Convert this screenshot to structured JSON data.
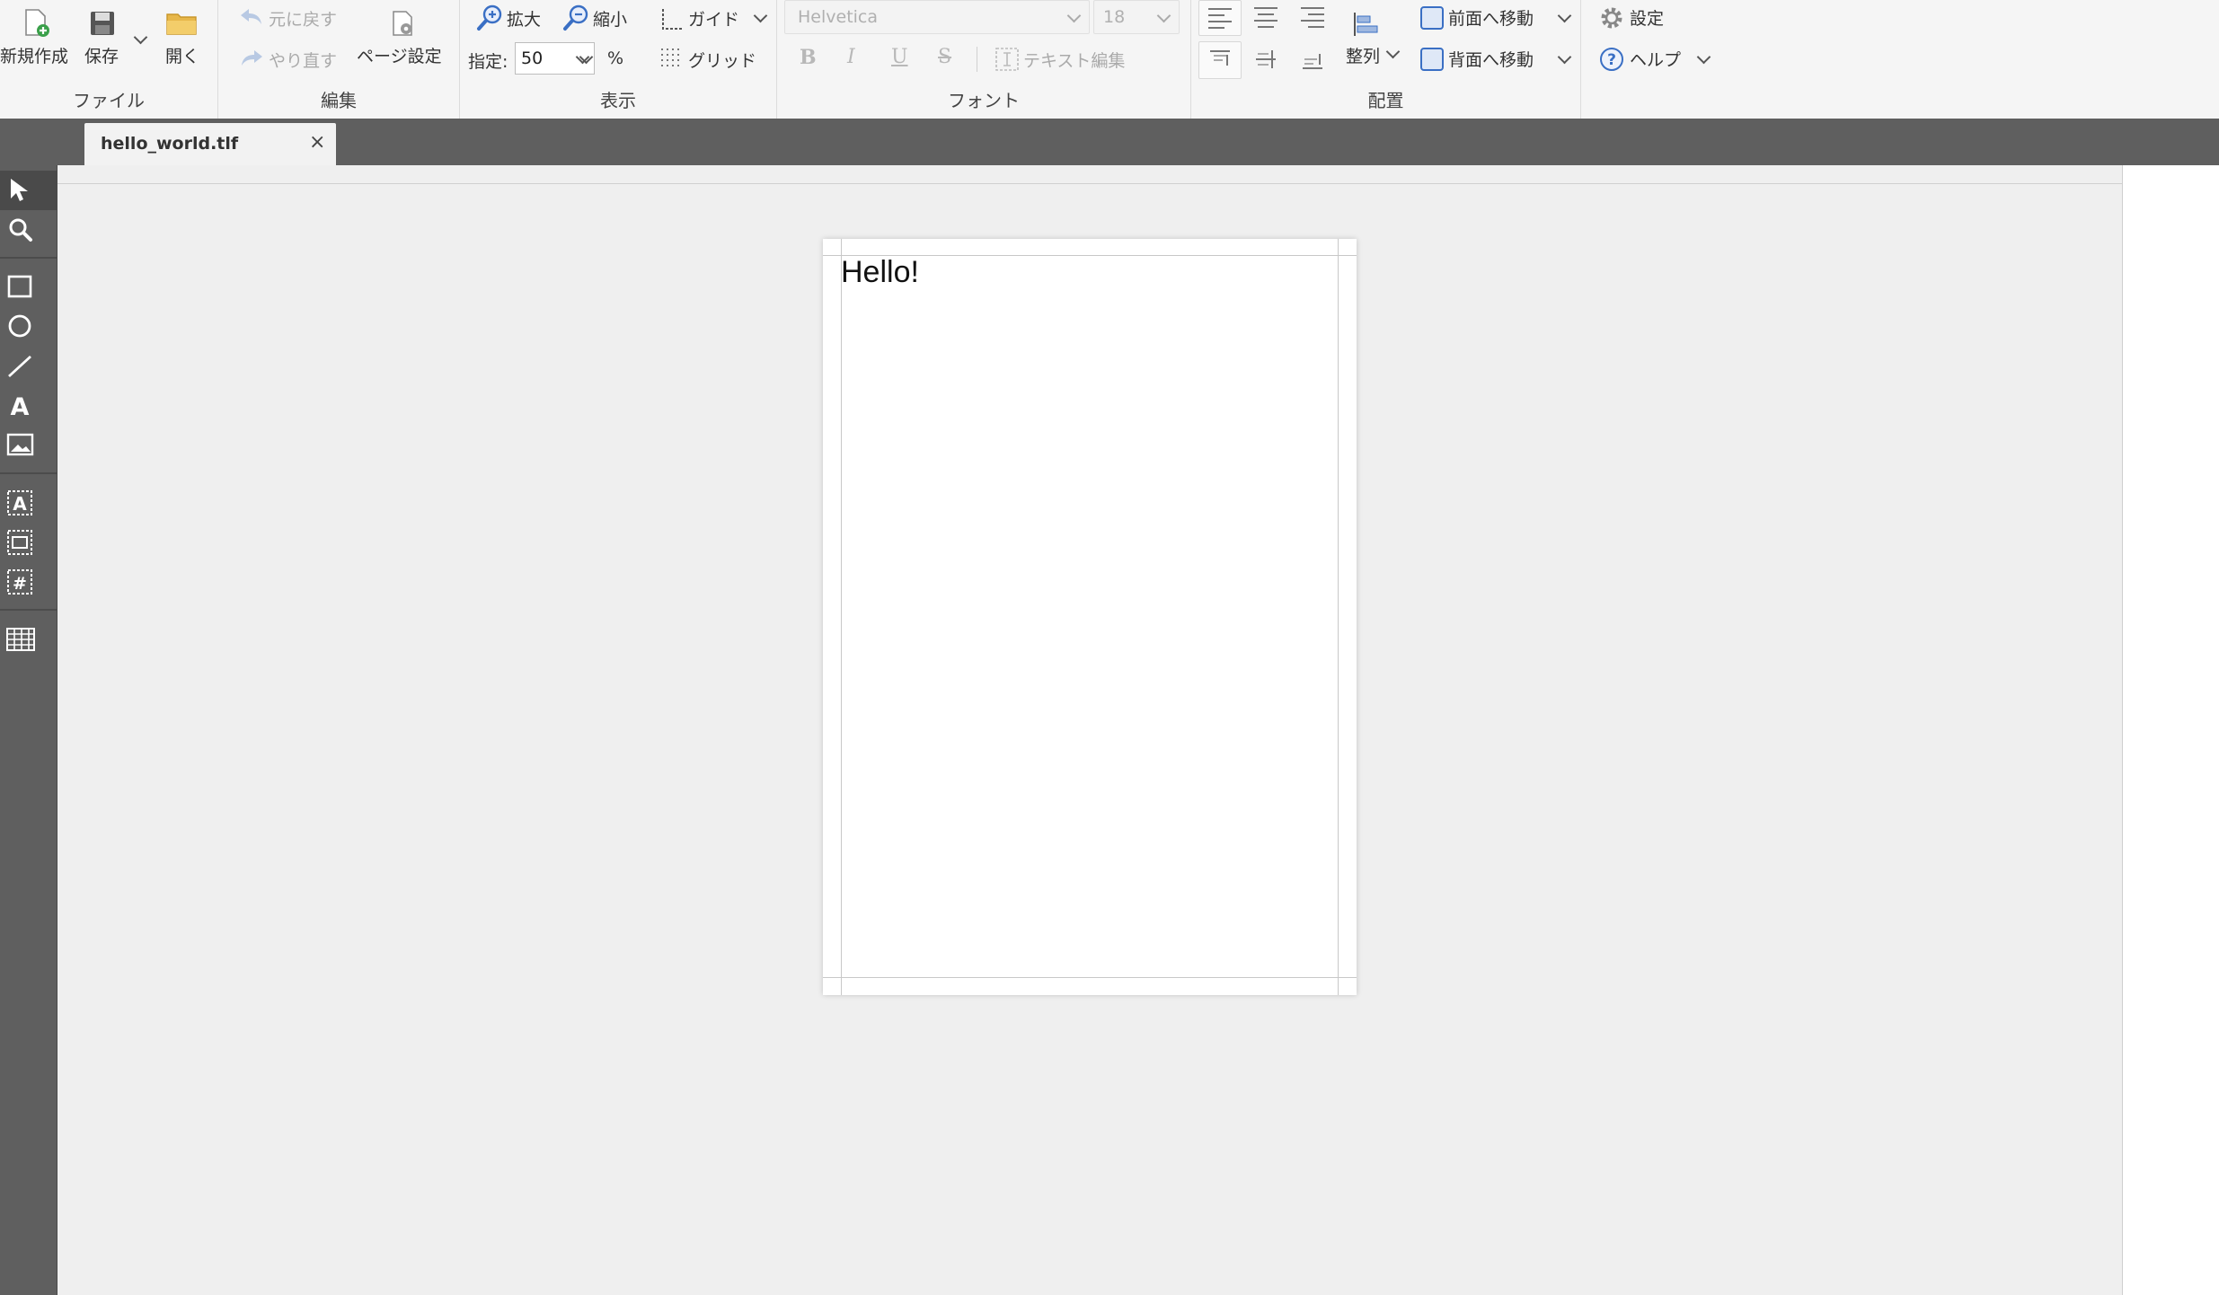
{
  "ribbon": {
    "file": {
      "group_label": "ファイル",
      "new_label": "新規作成",
      "save_label": "保存",
      "open_label": "開く"
    },
    "edit": {
      "group_label": "編集",
      "undo_label": "元に戻す",
      "redo_label": "やり直す",
      "page_setup_label": "ページ設定"
    },
    "view": {
      "group_label": "表示",
      "zoom_in_label": "拡大",
      "zoom_out_label": "縮小",
      "guide_label": "ガイド",
      "zoom_prefix": "指定:",
      "zoom_value": "50",
      "zoom_unit": "%",
      "grid_label": "グリッド"
    },
    "font": {
      "group_label": "フォント",
      "family": "Helvetica",
      "size": "18",
      "bold": "B",
      "italic": "I",
      "underline": "U",
      "strike": "S",
      "text_edit_label": "テキスト編集"
    },
    "arrange": {
      "group_label": "配置",
      "align_label": "整列",
      "bring_front_label": "前面へ移動",
      "send_back_label": "背面へ移動"
    },
    "misc": {
      "settings_label": "設定",
      "help_label": "ヘルプ"
    }
  },
  "tabs": [
    {
      "label": "hello_world.tlf",
      "close": "×"
    }
  ],
  "toolbox": [
    "select-tool",
    "zoom-tool",
    "rectangle-tool",
    "ellipse-tool",
    "line-tool",
    "text-tool",
    "image-tool",
    "text-block-tool",
    "image-block-tool",
    "page-number-tool",
    "list-tool"
  ],
  "page": {
    "text": "Hello!"
  },
  "colors": {
    "ribbon_bg": "#f5f5f5",
    "dark_bar": "#5f5f5f",
    "canvas_bg": "#efefef",
    "accent_blue": "#3a6fc4",
    "disabled_text": "#aaaaaa"
  }
}
